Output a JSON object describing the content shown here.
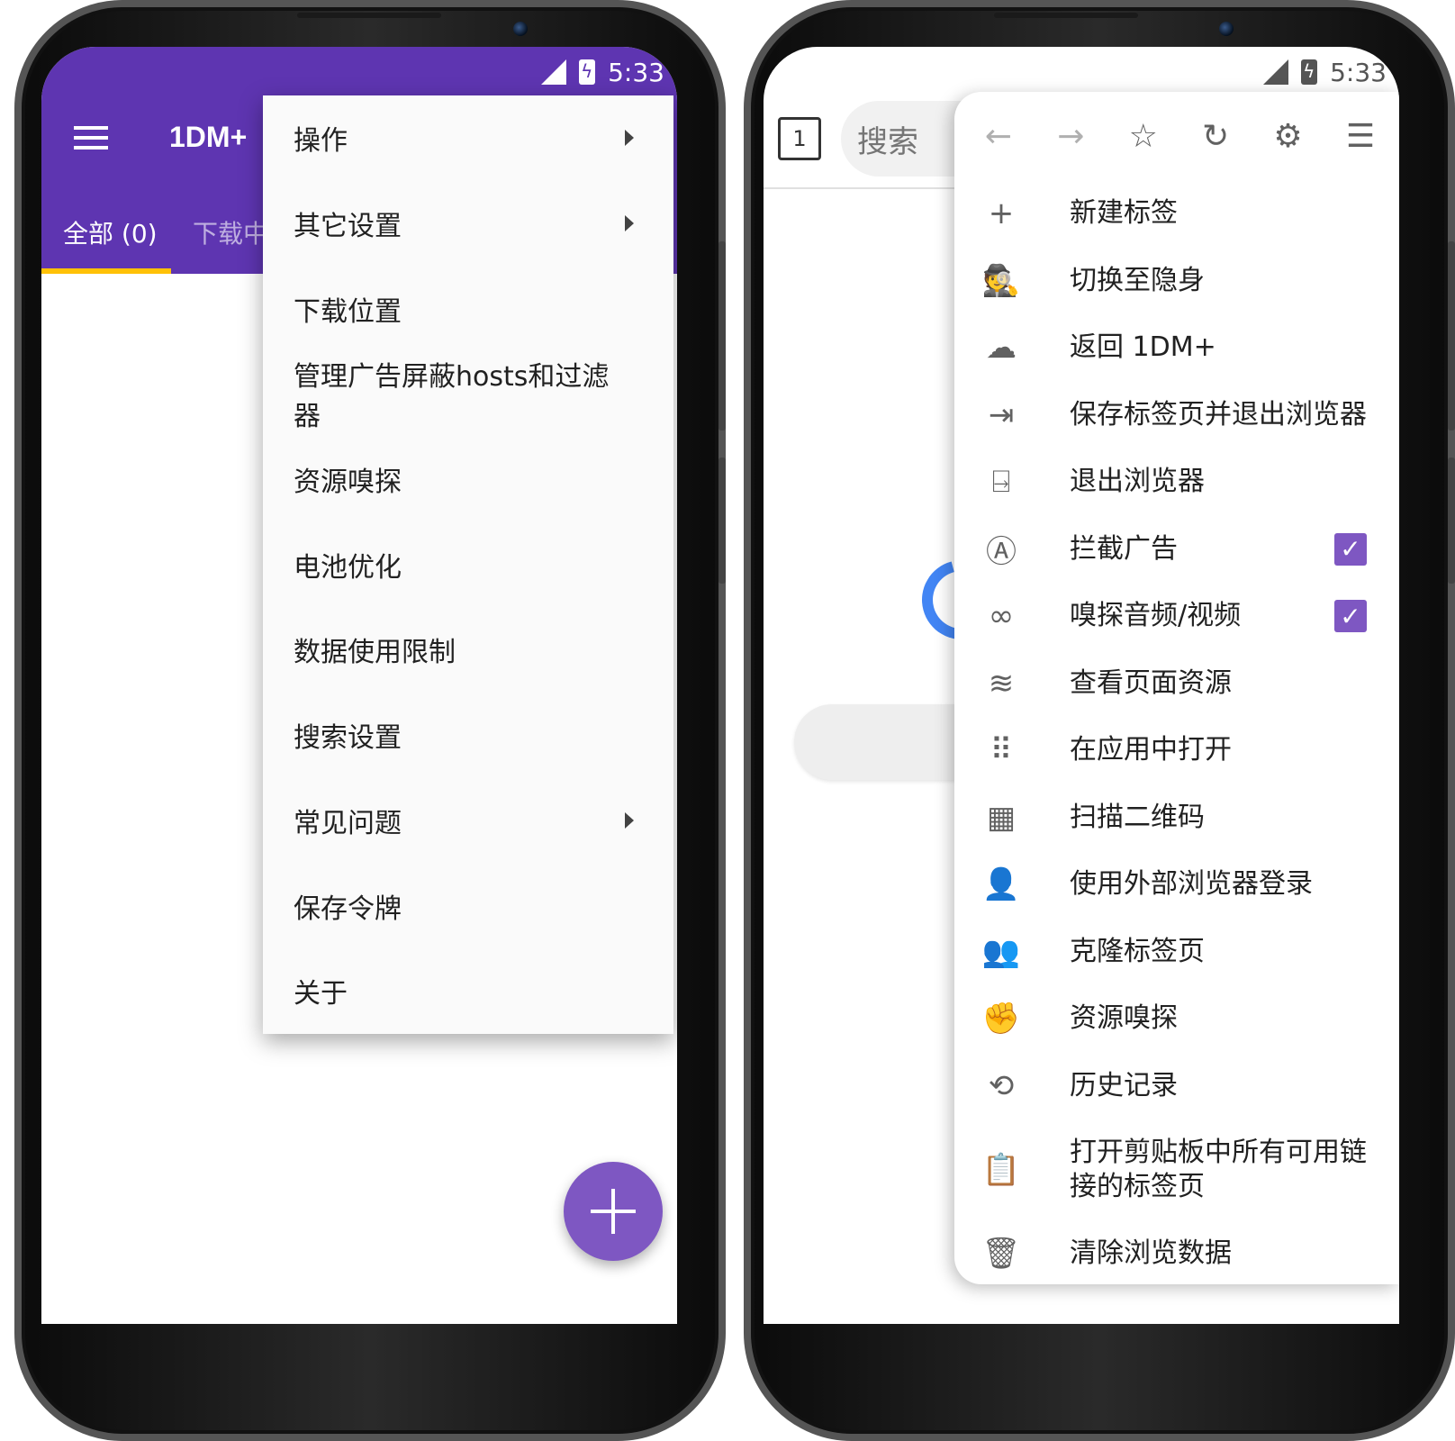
{
  "left_phone": {
    "status": {
      "time": "5:33"
    },
    "app": {
      "title": "1DM+",
      "tabs": [
        {
          "label": "全部 (0)"
        },
        {
          "label": "下载中"
        }
      ]
    },
    "menu": [
      {
        "label": "操作",
        "has_submenu": true
      },
      {
        "label": "其它设置",
        "has_submenu": true
      },
      {
        "label": "下载位置",
        "has_submenu": false
      },
      {
        "label": "管理广告屏蔽hosts和过滤器",
        "has_submenu": false
      },
      {
        "label": "资源嗅探",
        "has_submenu": false
      },
      {
        "label": "电池优化",
        "has_submenu": false
      },
      {
        "label": "数据使用限制",
        "has_submenu": false
      },
      {
        "label": "搜索设置",
        "has_submenu": false
      },
      {
        "label": "常见问题",
        "has_submenu": true
      },
      {
        "label": "保存令牌",
        "has_submenu": false
      },
      {
        "label": "关于",
        "has_submenu": false
      }
    ],
    "colors": {
      "primary": "#5e35b1",
      "accent": "#7e57c2",
      "indicator": "#ffc107"
    }
  },
  "right_phone": {
    "status": {
      "time": "5:33"
    },
    "browser": {
      "tab_count": "1",
      "search_placeholder": "搜索"
    },
    "toolbar_icons": [
      "back-arrow-icon",
      "forward-arrow-icon",
      "star-icon",
      "refresh-icon",
      "settings-gear-icon",
      "server-settings-icon"
    ],
    "menu": [
      {
        "label": "新建标签",
        "icon": "plus-icon"
      },
      {
        "label": "切换至隐身",
        "icon": "incognito-icon"
      },
      {
        "label": "返回 1DM+",
        "icon": "cloud-download-icon"
      },
      {
        "label": "保存标签页并退出浏览器",
        "icon": "save-exit-icon"
      },
      {
        "label": "退出浏览器",
        "icon": "exit-door-icon"
      },
      {
        "label": "拦截广告",
        "icon": "ad-block-icon",
        "checked": true
      },
      {
        "label": "嗅探音频/视频",
        "icon": "binoculars-icon",
        "checked": true
      },
      {
        "label": "查看页面资源",
        "icon": "layers-icon"
      },
      {
        "label": "在应用中打开",
        "icon": "apps-grid-icon"
      },
      {
        "label": "扫描二维码",
        "icon": "qr-code-icon"
      },
      {
        "label": "使用外部浏览器登录",
        "icon": "user-lock-icon"
      },
      {
        "label": "克隆标签页",
        "icon": "clone-people-icon"
      },
      {
        "label": "资源嗅探",
        "icon": "fist-icon"
      },
      {
        "label": "历史记录",
        "icon": "history-icon"
      },
      {
        "label": "打开剪贴板中所有可用链接的标签页",
        "icon": "clipboard-check-icon"
      },
      {
        "label": "清除浏览数据",
        "icon": "trash-icon"
      }
    ],
    "colors": {
      "checkbox": "#7e57c2",
      "spinner": "#4285f4"
    }
  }
}
